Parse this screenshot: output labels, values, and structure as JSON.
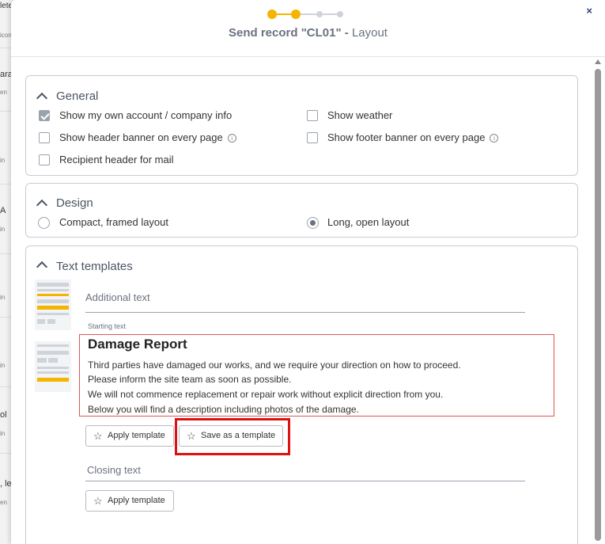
{
  "background": {
    "fragments": [
      "lete",
      "icon",
      "ara",
      "en",
      "in",
      "A",
      "in",
      "in",
      "in",
      "ol",
      "in",
      ", le",
      "en"
    ]
  },
  "header": {
    "title_bold": "Send record \"CL01\" -",
    "title_step": "Layout",
    "close_icon": "×",
    "steps": [
      "done",
      "active",
      "pending",
      "pending"
    ]
  },
  "general": {
    "title": "General",
    "options": [
      {
        "label": "Show my own account / company info",
        "checked": true
      },
      {
        "label": "Show weather",
        "checked": false
      },
      {
        "label": "Show header banner on every page",
        "checked": false,
        "info": true
      },
      {
        "label": "Show footer banner on every page",
        "checked": false,
        "info": true
      },
      {
        "label": "Recipient header for mail",
        "checked": false
      }
    ]
  },
  "design": {
    "title": "Design",
    "options": [
      {
        "label": "Compact, framed layout",
        "selected": false
      },
      {
        "label": "Long, open layout",
        "selected": true
      }
    ]
  },
  "text_templates": {
    "title": "Text templates",
    "additional_label": "Additional text",
    "starting_label": "Starting text",
    "starting_heading": "Damage Report",
    "starting_lines": [
      "Third parties have damaged our works, and we require your direction on how to proceed.",
      "Please inform the site team as soon as possible.",
      "We will not commence replacement or repair work without explicit direction from you.",
      "Below you will find a description including photos of the damage."
    ],
    "apply_template": "Apply template",
    "save_as_template": "Save as a template",
    "closing_label": "Closing text",
    "apply_template_closing": "Apply template"
  },
  "colors": {
    "accent": "#f5b400",
    "highlight": "#dd1111",
    "editor_border": "#e15555"
  }
}
